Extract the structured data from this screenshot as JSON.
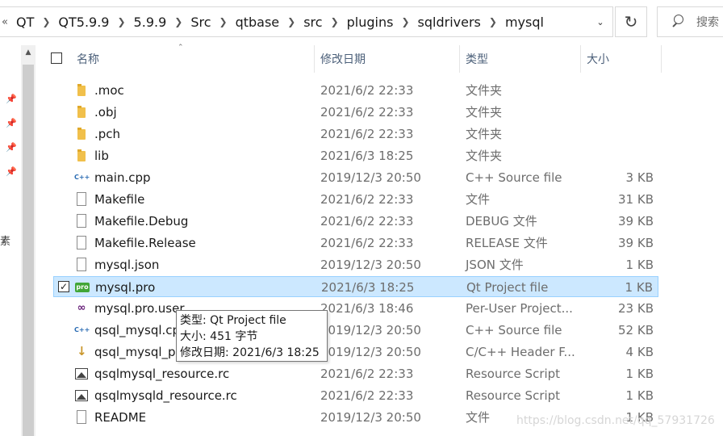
{
  "address": {
    "lead": "«",
    "crumbs": [
      "QT",
      "QT5.9.9",
      "5.9.9",
      "Src",
      "qtbase",
      "src",
      "plugins",
      "sqldrivers",
      "mysql"
    ],
    "dropdown_icon": "chevron-down-icon",
    "refresh_icon": "refresh-icon",
    "search_placeholder": "搜索"
  },
  "nav": {
    "partial_label": "素"
  },
  "columns": {
    "name": "名称",
    "date": "修改日期",
    "type": "类型",
    "size": "大小"
  },
  "files": [
    {
      "name": ".moc",
      "date": "2021/6/2 22:33",
      "type": "文件夹",
      "size": "",
      "icon": "folder"
    },
    {
      "name": ".obj",
      "date": "2021/6/2 22:33",
      "type": "文件夹",
      "size": "",
      "icon": "folder"
    },
    {
      "name": ".pch",
      "date": "2021/6/2 22:33",
      "type": "文件夹",
      "size": "",
      "icon": "folder"
    },
    {
      "name": "lib",
      "date": "2021/6/3 18:25",
      "type": "文件夹",
      "size": "",
      "icon": "folder"
    },
    {
      "name": "main.cpp",
      "date": "2019/12/3 20:50",
      "type": "C++ Source file",
      "size": "3 KB",
      "icon": "cpp"
    },
    {
      "name": "Makefile",
      "date": "2021/6/2 22:33",
      "type": "文件",
      "size": "31 KB",
      "icon": "doc"
    },
    {
      "name": "Makefile.Debug",
      "date": "2021/6/2 22:33",
      "type": "DEBUG 文件",
      "size": "39 KB",
      "icon": "doc"
    },
    {
      "name": "Makefile.Release",
      "date": "2021/6/2 22:33",
      "type": "RELEASE 文件",
      "size": "39 KB",
      "icon": "doc"
    },
    {
      "name": "mysql.json",
      "date": "2019/12/3 20:50",
      "type": "JSON 文件",
      "size": "1 KB",
      "icon": "doc"
    },
    {
      "name": "mysql.pro",
      "date": "2021/6/3 18:25",
      "type": "Qt Project file",
      "size": "1 KB",
      "icon": "pro",
      "selected": true,
      "checkmark": "✓"
    },
    {
      "name": "mysql.pro.user",
      "date": "2021/6/3 18:46",
      "type": "Per-User Project...",
      "size": "23 KB",
      "icon": "vs"
    },
    {
      "name": "qsql_mysql.cp",
      "date": "2019/12/3 20:50",
      "type": "C++ Source file",
      "size": "52 KB",
      "icon": "cpp"
    },
    {
      "name": "qsql_mysql_p.",
      "date": "2019/12/3 20:50",
      "type": "C/C++ Header F...",
      "size": "4 KB",
      "icon": "header"
    },
    {
      "name": "qsqlmysql_resource.rc",
      "date": "2021/6/2 22:33",
      "type": "Resource Script",
      "size": "1 KB",
      "icon": "image"
    },
    {
      "name": "qsqlmysqld_resource.rc",
      "date": "2021/6/2 22:33",
      "type": "Resource Script",
      "size": "1 KB",
      "icon": "image"
    },
    {
      "name": "README",
      "date": "2019/12/3 20:50",
      "type": "文件",
      "size": "1 KB",
      "icon": "doc"
    }
  ],
  "tooltip": {
    "line1": "类型: Qt Project file",
    "line2": "大小: 451 字节",
    "line3": "修改日期: 2021/6/3 18:25"
  },
  "watermark": "https://blog.csdn.net/qq_57931726",
  "colors": {
    "selection": "#cce8ff",
    "selection_border": "#99d1ff",
    "header_text": "#4c607a",
    "folder": "#f1c04b"
  }
}
